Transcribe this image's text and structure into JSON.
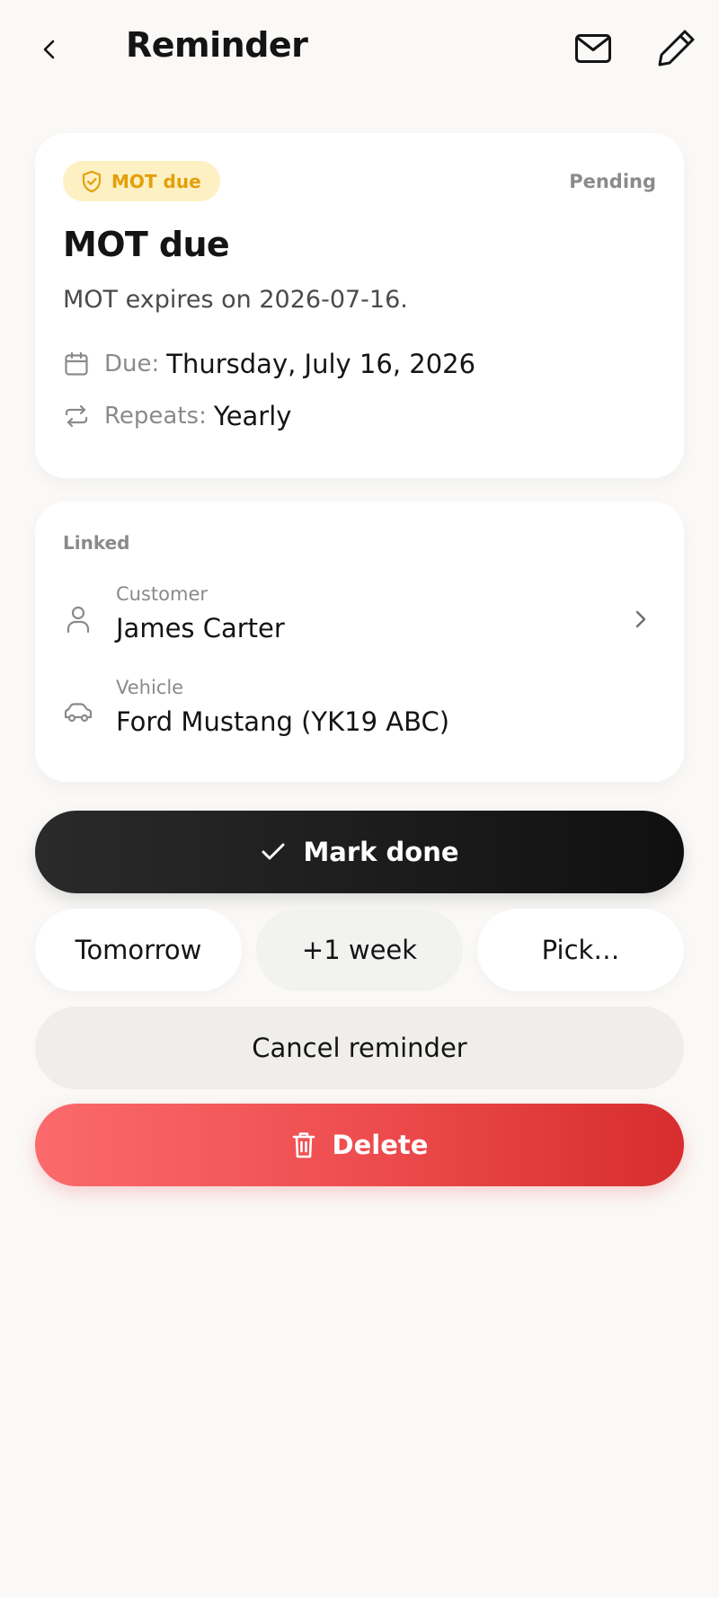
{
  "header": {
    "title": "Reminder",
    "back_icon": "chevron-left-icon",
    "mail_icon": "mail-icon",
    "edit_icon": "pencil-icon"
  },
  "reminder": {
    "badge_label": "MOT due",
    "badge_icon": "shield-check-icon",
    "status": "Pending",
    "title": "MOT due",
    "description": "MOT expires on 2026-07-16.",
    "due_label": "Due:",
    "due_value": "Thursday, July 16, 2026",
    "repeats_label": "Repeats:",
    "repeats_value": "Yearly"
  },
  "linked": {
    "section_label": "Linked",
    "customer_label": "Customer",
    "customer_value": "James Carter",
    "vehicle_label": "Vehicle",
    "vehicle_value": "Ford Mustang (YK19 ABC)"
  },
  "actions": {
    "mark_done": "Mark done",
    "snooze_tomorrow": "Tomorrow",
    "snooze_week": "+1 week",
    "snooze_pick": "Pick…",
    "cancel": "Cancel reminder",
    "delete": "Delete"
  },
  "colors": {
    "badge_bg": "#fdf0c2",
    "badge_text": "#e3a008",
    "primary_dark": "#1a1a1a",
    "danger": "#ee4d4f",
    "background": "#faf9f7"
  }
}
